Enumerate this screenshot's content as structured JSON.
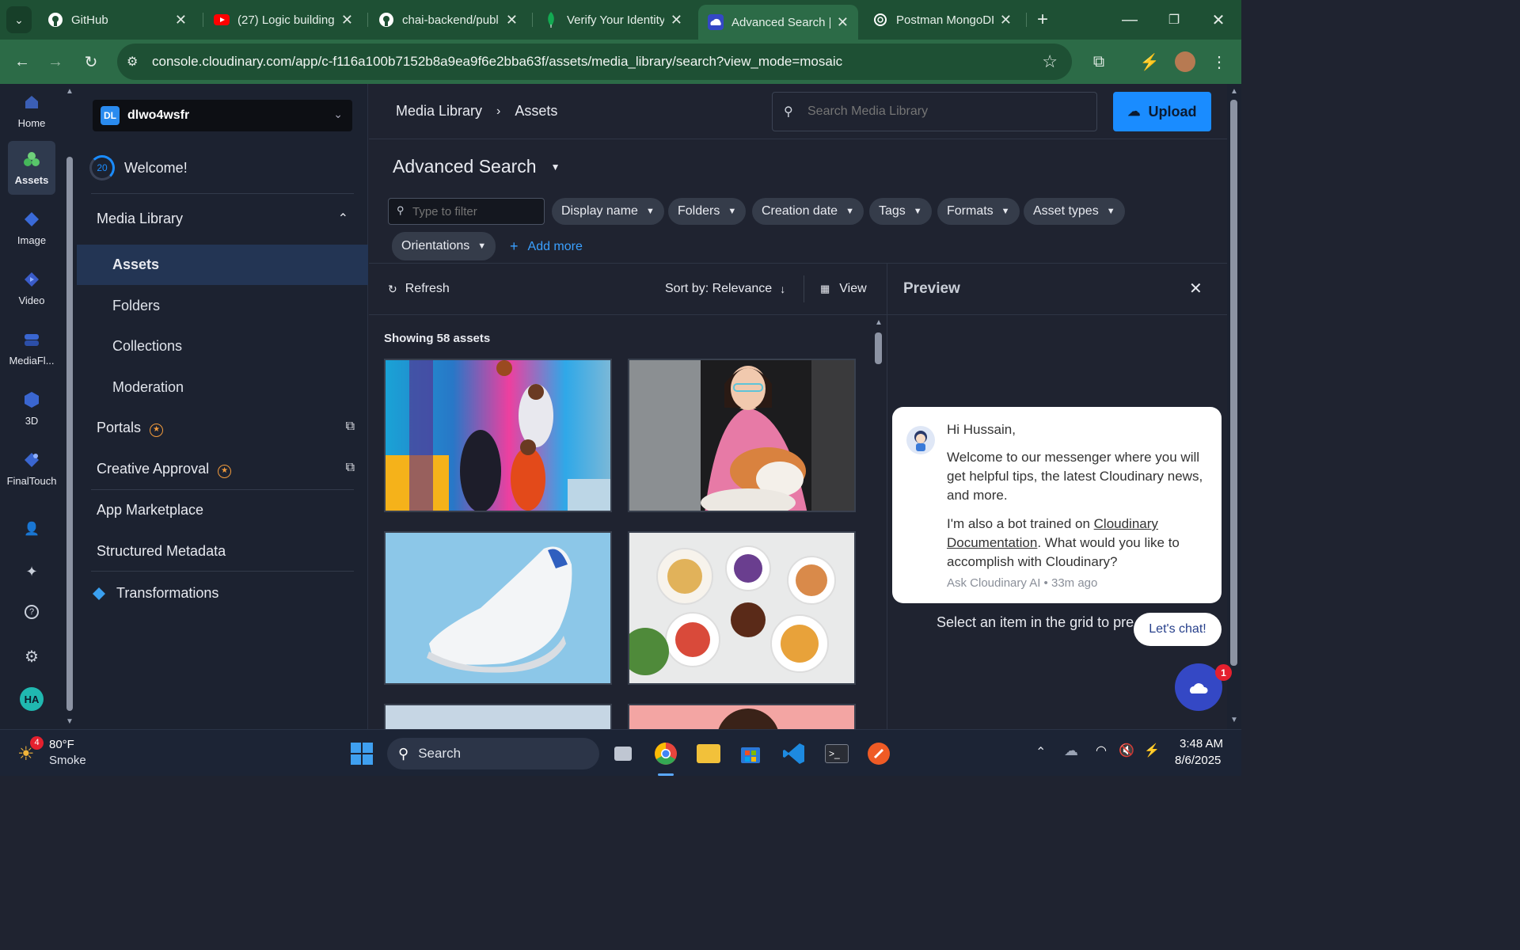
{
  "browser": {
    "tabs": [
      {
        "title": "GitHub",
        "icon": "github-icon"
      },
      {
        "title": "(27) Logic building",
        "icon": "youtube-icon"
      },
      {
        "title": "chai-backend/publ",
        "icon": "github-icon"
      },
      {
        "title": "Verify Your Identity",
        "icon": "mongodb-leaf-icon"
      },
      {
        "title": "Advanced Search |",
        "icon": "cloudinary-icon"
      },
      {
        "title": "Postman MongoDI",
        "icon": "openai-icon"
      }
    ],
    "url": "console.cloudinary.com/app/c-f116a100b7152b8a9ea9f6e2bba63f/assets/media_library/search?view_mode=mosaic"
  },
  "rail": {
    "items": [
      "Home",
      "Assets",
      "Image",
      "Video",
      "MediaFl...",
      "3D",
      "FinalTouch"
    ],
    "avatar": "HA"
  },
  "nav": {
    "account_badge": "DL",
    "account_name": "dlwo4wsfr",
    "welcome_count": "20",
    "welcome": "Welcome!",
    "media_library": "Media Library",
    "sub": [
      "Assets",
      "Folders",
      "Collections",
      "Moderation"
    ],
    "portals": "Portals",
    "creative_approval": "Creative Approval",
    "app_marketplace": "App Marketplace",
    "structured_metadata": "Structured Metadata",
    "transformations": "Transformations"
  },
  "header": {
    "breadcrumb_1": "Media Library",
    "breadcrumb_2": "Assets",
    "search_placeholder": "Search Media Library",
    "upload": "Upload"
  },
  "search": {
    "title": "Advanced Search",
    "filter_placeholder": "Type to filter",
    "chips": [
      "Display name",
      "Folders",
      "Creation date",
      "Tags",
      "Formats",
      "Asset types",
      "Orientations"
    ],
    "add_more": "Add more"
  },
  "toolbar": {
    "refresh": "Refresh",
    "sort": "Sort by: Relevance",
    "view": "View"
  },
  "results": {
    "count": "Showing 58 assets"
  },
  "preview": {
    "title": "Preview",
    "hint": "Select an item in the grid to pre"
  },
  "chat": {
    "greeting": "Hi Hussain,",
    "line1": "Welcome to our messenger where you will get helpful tips, the latest Cloudinary news, and more.",
    "line2_pre": "I'm also a bot trained on ",
    "line2_link": "Cloudinary Documentation",
    "line2_post": ". What would you like to accomplish with Cloudinary?",
    "meta": "Ask Cloudinary AI • 33m ago",
    "cta": "Let's chat!",
    "badge": "1"
  },
  "taskbar": {
    "weather_badge": "4",
    "temp": "80°F",
    "weather": "Smoke",
    "search": "Search",
    "time": "3:48 AM",
    "date": "8/6/2025"
  },
  "colors": {
    "accent": "#1a8cff",
    "browser_green": "#2c6b47",
    "panel": "#1c2230"
  }
}
